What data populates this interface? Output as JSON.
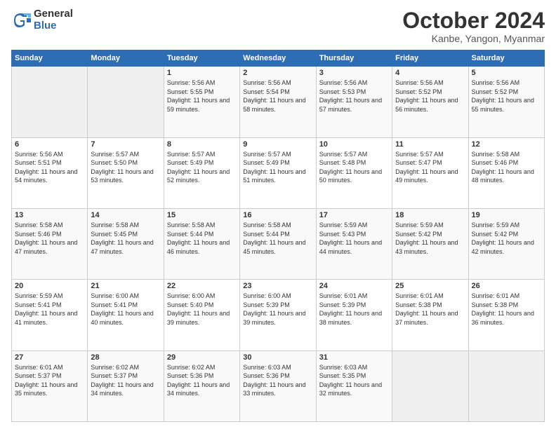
{
  "logo": {
    "general": "General",
    "blue": "Blue"
  },
  "header": {
    "title": "October 2024",
    "location": "Kanbe, Yangon, Myanmar"
  },
  "weekdays": [
    "Sunday",
    "Monday",
    "Tuesday",
    "Wednesday",
    "Thursday",
    "Friday",
    "Saturday"
  ],
  "weeks": [
    [
      {
        "day": "",
        "sunrise": "",
        "sunset": "",
        "daylight": ""
      },
      {
        "day": "",
        "sunrise": "",
        "sunset": "",
        "daylight": ""
      },
      {
        "day": "1",
        "sunrise": "Sunrise: 5:56 AM",
        "sunset": "Sunset: 5:55 PM",
        "daylight": "Daylight: 11 hours and 59 minutes."
      },
      {
        "day": "2",
        "sunrise": "Sunrise: 5:56 AM",
        "sunset": "Sunset: 5:54 PM",
        "daylight": "Daylight: 11 hours and 58 minutes."
      },
      {
        "day": "3",
        "sunrise": "Sunrise: 5:56 AM",
        "sunset": "Sunset: 5:53 PM",
        "daylight": "Daylight: 11 hours and 57 minutes."
      },
      {
        "day": "4",
        "sunrise": "Sunrise: 5:56 AM",
        "sunset": "Sunset: 5:52 PM",
        "daylight": "Daylight: 11 hours and 56 minutes."
      },
      {
        "day": "5",
        "sunrise": "Sunrise: 5:56 AM",
        "sunset": "Sunset: 5:52 PM",
        "daylight": "Daylight: 11 hours and 55 minutes."
      }
    ],
    [
      {
        "day": "6",
        "sunrise": "Sunrise: 5:56 AM",
        "sunset": "Sunset: 5:51 PM",
        "daylight": "Daylight: 11 hours and 54 minutes."
      },
      {
        "day": "7",
        "sunrise": "Sunrise: 5:57 AM",
        "sunset": "Sunset: 5:50 PM",
        "daylight": "Daylight: 11 hours and 53 minutes."
      },
      {
        "day": "8",
        "sunrise": "Sunrise: 5:57 AM",
        "sunset": "Sunset: 5:49 PM",
        "daylight": "Daylight: 11 hours and 52 minutes."
      },
      {
        "day": "9",
        "sunrise": "Sunrise: 5:57 AM",
        "sunset": "Sunset: 5:49 PM",
        "daylight": "Daylight: 11 hours and 51 minutes."
      },
      {
        "day": "10",
        "sunrise": "Sunrise: 5:57 AM",
        "sunset": "Sunset: 5:48 PM",
        "daylight": "Daylight: 11 hours and 50 minutes."
      },
      {
        "day": "11",
        "sunrise": "Sunrise: 5:57 AM",
        "sunset": "Sunset: 5:47 PM",
        "daylight": "Daylight: 11 hours and 49 minutes."
      },
      {
        "day": "12",
        "sunrise": "Sunrise: 5:58 AM",
        "sunset": "Sunset: 5:46 PM",
        "daylight": "Daylight: 11 hours and 48 minutes."
      }
    ],
    [
      {
        "day": "13",
        "sunrise": "Sunrise: 5:58 AM",
        "sunset": "Sunset: 5:46 PM",
        "daylight": "Daylight: 11 hours and 47 minutes."
      },
      {
        "day": "14",
        "sunrise": "Sunrise: 5:58 AM",
        "sunset": "Sunset: 5:45 PM",
        "daylight": "Daylight: 11 hours and 47 minutes."
      },
      {
        "day": "15",
        "sunrise": "Sunrise: 5:58 AM",
        "sunset": "Sunset: 5:44 PM",
        "daylight": "Daylight: 11 hours and 46 minutes."
      },
      {
        "day": "16",
        "sunrise": "Sunrise: 5:58 AM",
        "sunset": "Sunset: 5:44 PM",
        "daylight": "Daylight: 11 hours and 45 minutes."
      },
      {
        "day": "17",
        "sunrise": "Sunrise: 5:59 AM",
        "sunset": "Sunset: 5:43 PM",
        "daylight": "Daylight: 11 hours and 44 minutes."
      },
      {
        "day": "18",
        "sunrise": "Sunrise: 5:59 AM",
        "sunset": "Sunset: 5:42 PM",
        "daylight": "Daylight: 11 hours and 43 minutes."
      },
      {
        "day": "19",
        "sunrise": "Sunrise: 5:59 AM",
        "sunset": "Sunset: 5:42 PM",
        "daylight": "Daylight: 11 hours and 42 minutes."
      }
    ],
    [
      {
        "day": "20",
        "sunrise": "Sunrise: 5:59 AM",
        "sunset": "Sunset: 5:41 PM",
        "daylight": "Daylight: 11 hours and 41 minutes."
      },
      {
        "day": "21",
        "sunrise": "Sunrise: 6:00 AM",
        "sunset": "Sunset: 5:41 PM",
        "daylight": "Daylight: 11 hours and 40 minutes."
      },
      {
        "day": "22",
        "sunrise": "Sunrise: 6:00 AM",
        "sunset": "Sunset: 5:40 PM",
        "daylight": "Daylight: 11 hours and 39 minutes."
      },
      {
        "day": "23",
        "sunrise": "Sunrise: 6:00 AM",
        "sunset": "Sunset: 5:39 PM",
        "daylight": "Daylight: 11 hours and 39 minutes."
      },
      {
        "day": "24",
        "sunrise": "Sunrise: 6:01 AM",
        "sunset": "Sunset: 5:39 PM",
        "daylight": "Daylight: 11 hours and 38 minutes."
      },
      {
        "day": "25",
        "sunrise": "Sunrise: 6:01 AM",
        "sunset": "Sunset: 5:38 PM",
        "daylight": "Daylight: 11 hours and 37 minutes."
      },
      {
        "day": "26",
        "sunrise": "Sunrise: 6:01 AM",
        "sunset": "Sunset: 5:38 PM",
        "daylight": "Daylight: 11 hours and 36 minutes."
      }
    ],
    [
      {
        "day": "27",
        "sunrise": "Sunrise: 6:01 AM",
        "sunset": "Sunset: 5:37 PM",
        "daylight": "Daylight: 11 hours and 35 minutes."
      },
      {
        "day": "28",
        "sunrise": "Sunrise: 6:02 AM",
        "sunset": "Sunset: 5:37 PM",
        "daylight": "Daylight: 11 hours and 34 minutes."
      },
      {
        "day": "29",
        "sunrise": "Sunrise: 6:02 AM",
        "sunset": "Sunset: 5:36 PM",
        "daylight": "Daylight: 11 hours and 34 minutes."
      },
      {
        "day": "30",
        "sunrise": "Sunrise: 6:03 AM",
        "sunset": "Sunset: 5:36 PM",
        "daylight": "Daylight: 11 hours and 33 minutes."
      },
      {
        "day": "31",
        "sunrise": "Sunrise: 6:03 AM",
        "sunset": "Sunset: 5:35 PM",
        "daylight": "Daylight: 11 hours and 32 minutes."
      },
      {
        "day": "",
        "sunrise": "",
        "sunset": "",
        "daylight": ""
      },
      {
        "day": "",
        "sunrise": "",
        "sunset": "",
        "daylight": ""
      }
    ]
  ]
}
